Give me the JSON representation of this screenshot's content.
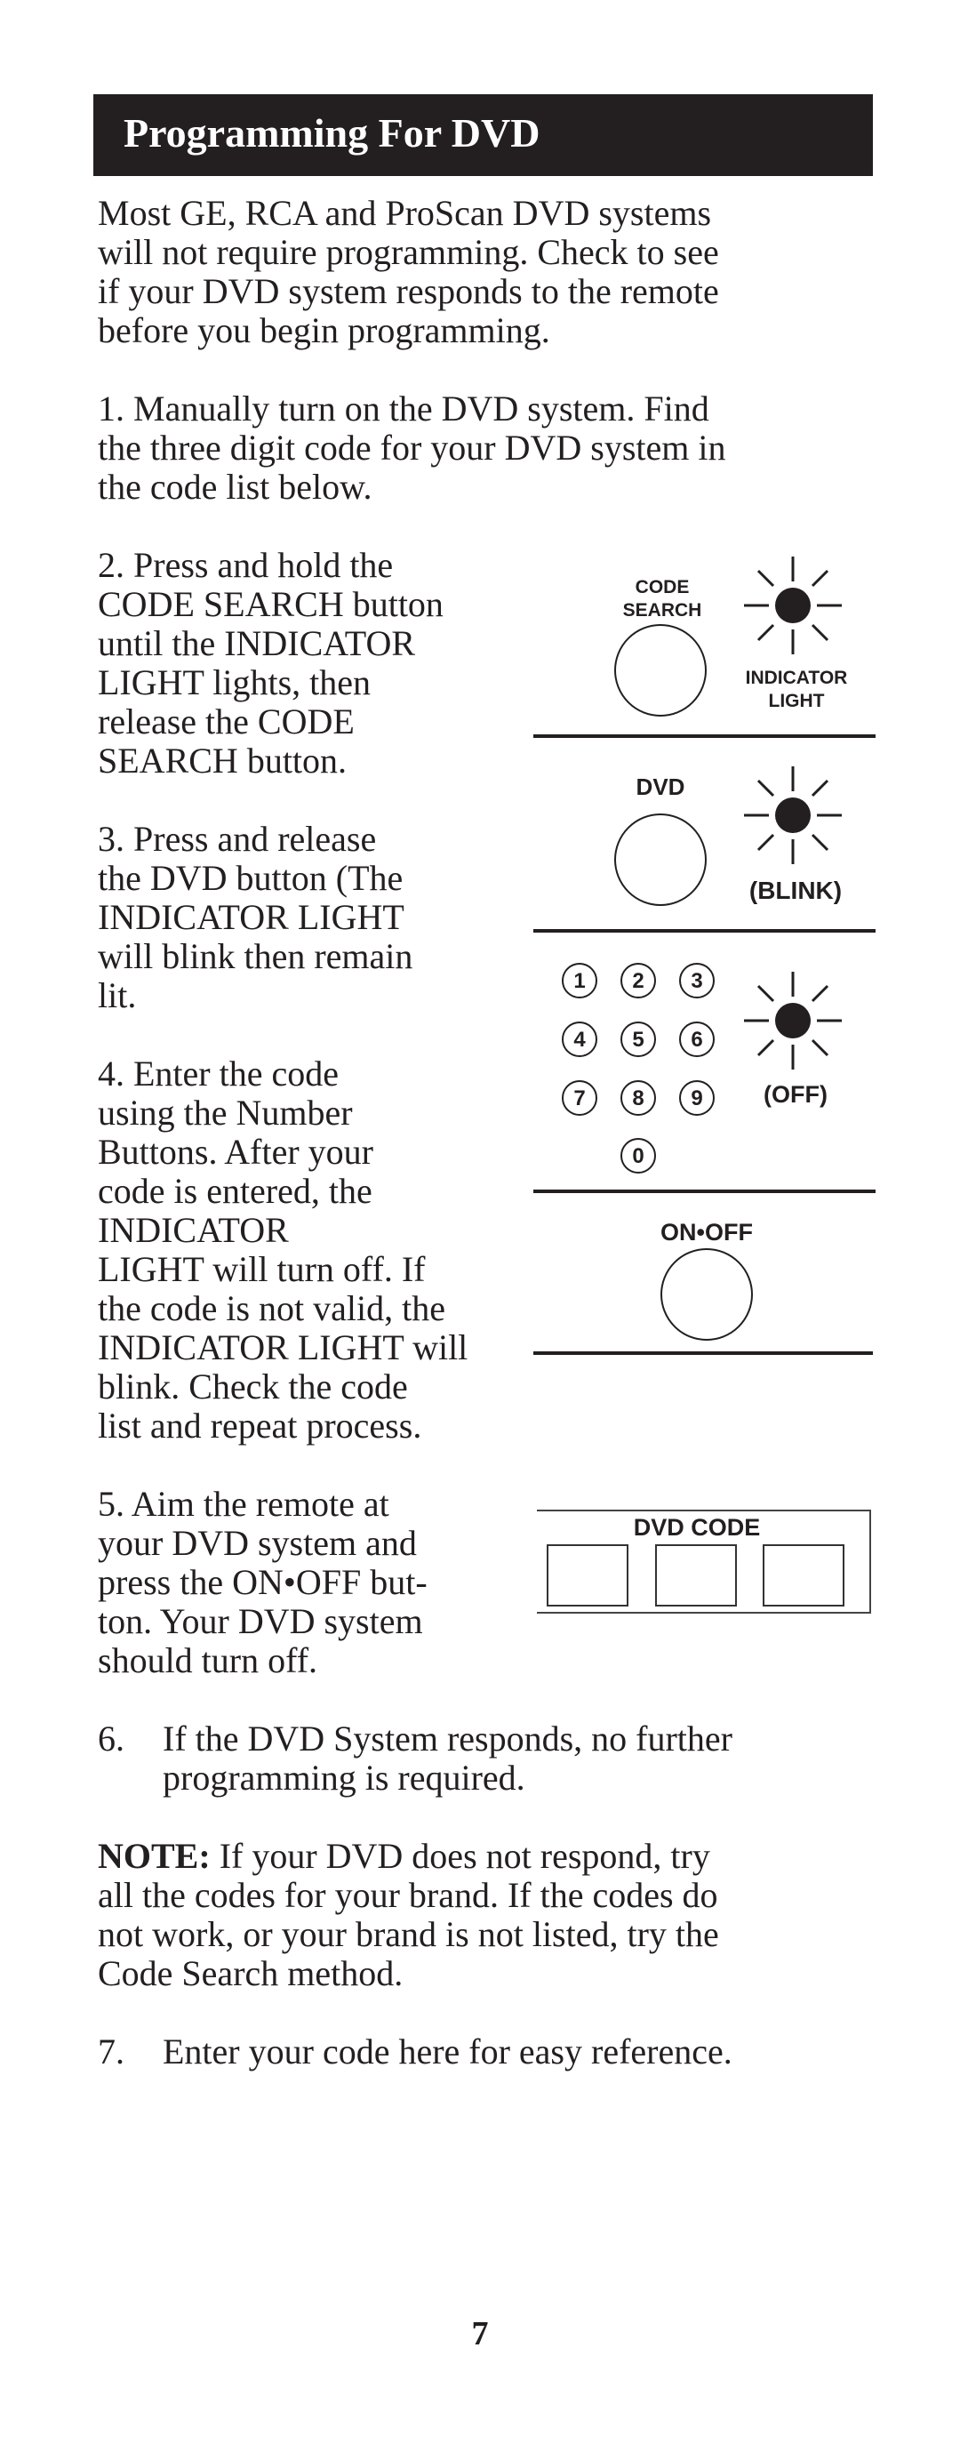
{
  "header": {
    "title": "Programming For DVD"
  },
  "intro": "Most GE, RCA and ProScan DVD systems\nwill not require programming. Check to see\nif your DVD system responds to the remote\nbefore you begin programming.",
  "steps": [
    {
      "number": "1.",
      "text": "1.    Manually turn on the DVD system. Find\nthe three digit code for your DVD system in\nthe code list below."
    },
    {
      "number": "2.",
      "text": "2.    Press and hold the\nCODE SEARCH button\nuntil the INDICATOR\nLIGHT lights, then\nrelease the CODE\nSEARCH button."
    },
    {
      "number": "3.",
      "text": "3.    Press and release\nthe DVD button (The\nINDICATOR LIGHT\nwill blink then remain\nlit."
    },
    {
      "number": "4.",
      "text": "4.    Enter the code\nusing the Number\nButtons. After your\ncode is entered, the\nINDICATOR\nLIGHT will turn off. If\nthe code is not valid, the\nINDICATOR LIGHT will\nblink. Check the code\nlist and repeat process."
    },
    {
      "number": "5.",
      "text": "5.    Aim the remote at\nyour DVD system and\npress the ON•OFF but-\nton. Your DVD system\nshould turn off."
    },
    {
      "number": "6.",
      "text": "If the DVD System responds, no further\nprogramming is required."
    },
    {
      "number": "7.",
      "text": "Enter your code here for easy reference."
    }
  ],
  "note": {
    "label": "NOTE:",
    "text": " If your DVD does not respond, try\nall the codes for your brand. If the codes do\nnot work, or your brand is not listed, try the\nCode Search method."
  },
  "diagram": {
    "code_search_label": "CODE\nSEARCH",
    "indicator_label": "INDICATOR\nLIGHT",
    "dvd_label": "DVD",
    "blink_label": "(BLINK)",
    "off_label": "(OFF)",
    "on_off_label": "ON•OFF",
    "keypad_keys": [
      "1",
      "2",
      "3",
      "4",
      "5",
      "6",
      "7",
      "8",
      "9",
      "0"
    ],
    "dvd_code_label": "DVD CODE",
    "dvd_code_cells": [
      "",
      "",
      ""
    ]
  },
  "page_number": "7"
}
